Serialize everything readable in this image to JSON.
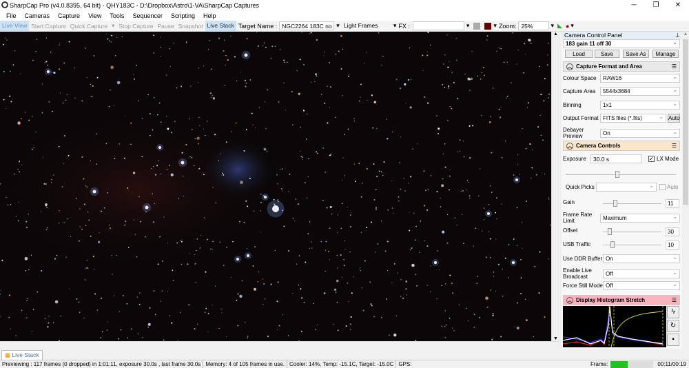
{
  "window": {
    "title": "SharpCap Pro (v4.0.8395, 64 bit) - QHY183C - D:\\Dropbox\\Astro\\1-VA\\SharpCap Captures",
    "minimize": "─",
    "maximize": "❐",
    "close": "✕"
  },
  "menu": [
    "File",
    "Cameras",
    "Capture",
    "View",
    "Tools",
    "Sequencer",
    "Scripting",
    "Help"
  ],
  "toolbar": {
    "live_view": "Live View",
    "start_capture": "Start Capture",
    "quick_capture": "Quick Capture",
    "stop_capture": "Stop Capture",
    "pause": "Pause",
    "snapshot": "Snapshot",
    "live_stack": "Live Stack",
    "target_label": "Target Name :",
    "target_value": "NGC2264 183C no",
    "frame_type": "Light Frames",
    "fx_label": "FX :",
    "fx_value": "",
    "zoom_label": "Zoom:",
    "zoom_value": "25%"
  },
  "panel": {
    "title": "Camera Control Panel",
    "profile": "183 gain 11 off 30",
    "buttons": {
      "load": "Load",
      "save": "Save",
      "save_as": "Save As ...",
      "manage": "Manage ..."
    },
    "capture_format": {
      "title": "Capture Format and Area",
      "colour_space_label": "Colour Space",
      "colour_space": "RAW16",
      "capture_area_label": "Capture Area",
      "capture_area": "5544x3684",
      "binning_label": "Binning",
      "binning": "1x1",
      "output_format_label": "Output Format",
      "output_format": "FITS files (*.fits)",
      "auto": "Auto",
      "debayer_label": "Debayer Preview",
      "debayer": "On"
    },
    "camera_controls": {
      "title": "Camera Controls",
      "exposure_label": "Exposure",
      "exposure": "30.0 s",
      "lx_mode": "LX Mode",
      "quick_picks_label": "Quick Picks",
      "quick_picks": "",
      "auto": "Auto",
      "gain_label": "Gain",
      "gain": "11",
      "frame_rate_label": "Frame Rate Limit",
      "frame_rate": "Maximum",
      "offset_label": "Offset",
      "offset": "30",
      "usb_label": "USB Traffic",
      "usb": "10",
      "ddr_label": "Use DDR Buffer",
      "ddr": "On",
      "broadcast_label": "Enable Live Broadcast",
      "broadcast": "Off",
      "still_label": "Force Still Mode",
      "still": "Off"
    },
    "histogram": {
      "title": "Display Histogram Stretch"
    }
  },
  "tab": {
    "label": "Live Stack"
  },
  "status": {
    "preview": "Previewing : 117 frames (0 dropped) in 1:01:11, exposure 30.0s , last frame 30.0s",
    "memory": "Memory: 4 of 105 frames in use.",
    "cooler": "Cooler: 14%, Temp: -15.1C, Target: -15.0C",
    "gps": "GPS:",
    "frame_label": "Frame:",
    "frame_progress": 0.4,
    "time": "00:11/00:19"
  },
  "colors": {
    "accent": "#cde3f5",
    "capture_header": "#e8e8e8",
    "controls_header": "#fbe6cc",
    "histogram_header": "#f9b5bd",
    "progress": "#22c022"
  }
}
